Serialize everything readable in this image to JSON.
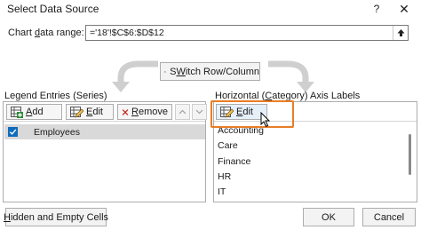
{
  "window": {
    "title": "Select Data Source",
    "help_glyph": "?",
    "close_glyph": "✕"
  },
  "range": {
    "label_pre": "Chart ",
    "label_ul": "d",
    "label_post": "ata range:",
    "value": "='18'!$C$6:$D$12"
  },
  "switch_button": {
    "label_ul": "W",
    "label_pre": "S",
    "label_post": "itch Row/Column"
  },
  "legend": {
    "label_pre": "Le",
    "label_ul": "g",
    "label_post": "end Entries (Series)",
    "add_ul": "A",
    "add_post": "dd",
    "edit_ul": "E",
    "edit_post": "dit",
    "remove_ul": "R",
    "remove_post": "emove",
    "series": [
      {
        "name": "Employees",
        "checked": true
      }
    ]
  },
  "axis": {
    "label_pre": "Horizontal (",
    "label_ul": "C",
    "label_post": "ategory) Axis Labels",
    "edit_ul": "E",
    "edit_post": "dit",
    "items": [
      "Accounting",
      "Care",
      "Finance",
      "HR",
      "IT"
    ]
  },
  "buttons": {
    "hidden_ul": "H",
    "hidden_post": "idden and Empty Cells",
    "ok": "OK",
    "cancel": "Cancel"
  },
  "colors": {
    "accent": "#0f6cbd",
    "highlight": "#e87d27",
    "selected_row": "#d9d9d9"
  }
}
